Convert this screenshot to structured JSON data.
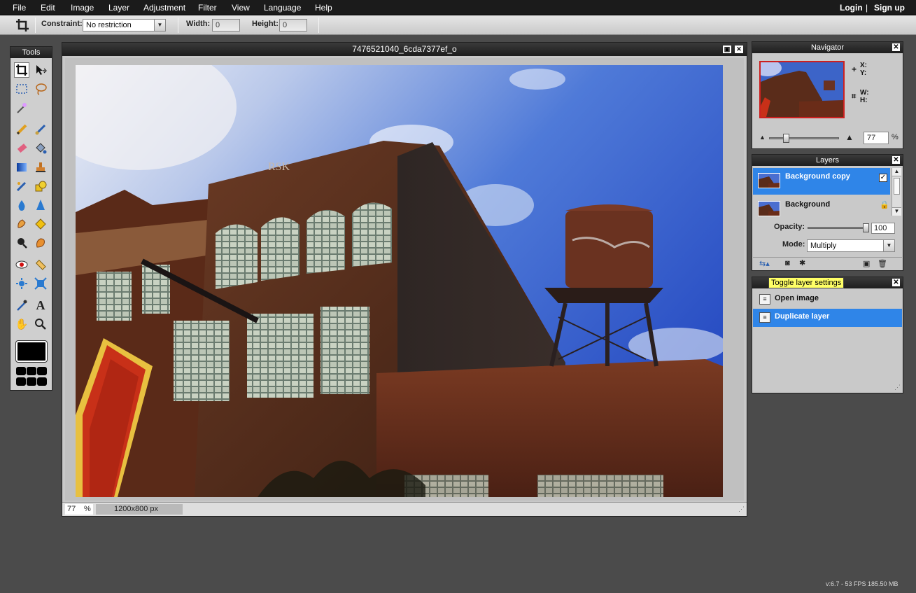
{
  "menu": {
    "items": [
      "File",
      "Edit",
      "Image",
      "Layer",
      "Adjustment",
      "Filter",
      "View",
      "Language",
      "Help"
    ],
    "login": "Login",
    "separator": "|",
    "signup": "Sign up"
  },
  "options": {
    "constraint_label": "Constraint:",
    "constraint_value": "No restriction",
    "width_label": "Width:",
    "width_value": "0",
    "height_label": "Height:",
    "height_value": "0"
  },
  "tools": {
    "title": "Tools",
    "icons": [
      "crop-icon",
      "move-icon",
      "marquee-icon",
      "lasso-icon",
      "wand-icon",
      "pencil-icon",
      "brush-icon",
      "eraser-icon",
      "fill-icon",
      "gradient-icon",
      "stamp-icon",
      "replace-color-icon",
      "shape-icon",
      "blur-icon",
      "sharpen-icon",
      "smudge-icon",
      "sponge-icon",
      "dodge-icon",
      "burn-icon",
      "red-eye-icon",
      "spot-heal-icon",
      "bloat-icon",
      "pinch-icon",
      "color-picker-icon",
      "text-icon",
      "hand-icon",
      "zoom-icon"
    ],
    "foreground_color": "#000000"
  },
  "document": {
    "title": "7476521040_6cda7377ef_o",
    "zoom": "77",
    "zoom_unit": "%",
    "dimensions": "1200x800 px"
  },
  "navigator": {
    "title": "Navigator",
    "x_label": "X:",
    "y_label": "Y:",
    "w_label": "W:",
    "h_label": "H:",
    "zoom": "77",
    "zoom_unit": "%"
  },
  "layers": {
    "title": "Layers",
    "items": [
      {
        "name": "Background copy",
        "selected": true
      },
      {
        "name": "Background",
        "selected": false
      }
    ],
    "opacity_label": "Opacity:",
    "opacity_value": "100",
    "mode_label": "Mode:",
    "mode_value": "Multiply"
  },
  "history": {
    "tooltip": "Toggle layer settings",
    "items": [
      {
        "name": "Open image",
        "selected": false
      },
      {
        "name": "Duplicate layer",
        "selected": true
      }
    ]
  },
  "status": {
    "version": "v:6.7 - 53 FPS 185.50 MB"
  },
  "colors": {
    "accent": "#2f85e8",
    "menubar": "#1b1b1b",
    "workspace": "#4b4b4b"
  }
}
